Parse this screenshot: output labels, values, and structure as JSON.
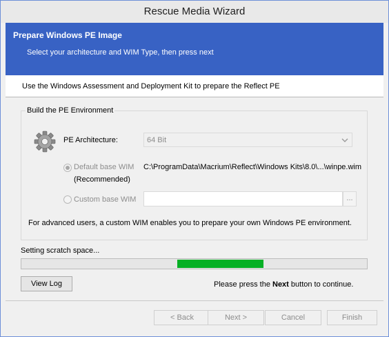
{
  "window": {
    "title": "Rescue Media Wizard"
  },
  "banner": {
    "heading": "Prepare Windows PE Image",
    "subheading": "Select your architecture and WIM Type, then press next"
  },
  "info": {
    "text": "Use the Windows Assessment and Deployment Kit to prepare the Reflect PE"
  },
  "group": {
    "legend": "Build the PE Environment",
    "architecture_label": "PE Architecture:",
    "architecture_value": "64 Bit",
    "default_wim_label": "Default base WIM",
    "default_wim_recommended": "(Recommended)",
    "default_wim_path": "C:\\ProgramData\\Macrium\\Reflect\\Windows Kits\\8.0\\...\\winpe.wim",
    "custom_wim_label": "Custom base WIM",
    "custom_wim_value": "",
    "browse_label": "...",
    "note": "For advanced users, a custom WIM enables you to prepare your own Windows PE environment."
  },
  "status": {
    "text": "Setting scratch space...",
    "progress_segment": {
      "start": 0.451,
      "end": 0.701
    }
  },
  "view_log_label": "View Log",
  "hint": {
    "before": "Please press the ",
    "bold": "Next",
    "after": "  button to continue."
  },
  "footer": {
    "back_label": "< Back",
    "next_label": "Next >",
    "cancel_label": "Cancel",
    "finish_label": "Finish"
  },
  "colors": {
    "banner": "#3862c4",
    "progress_fill": "#06b025",
    "window_border": "#6d8fd8"
  }
}
